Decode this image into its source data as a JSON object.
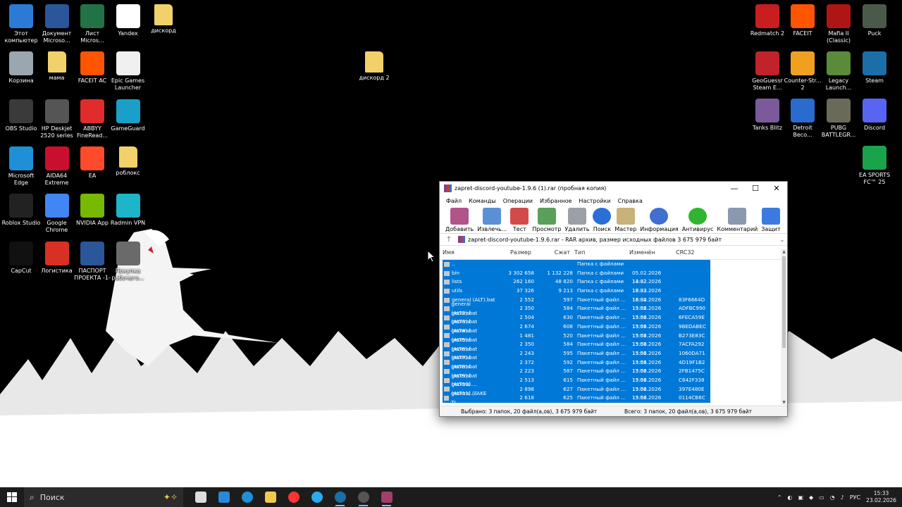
{
  "desktop": {
    "icons": [
      {
        "label": "Этот компьютер",
        "icon": "computer-icon",
        "color": "#2b7bd6"
      },
      {
        "label": "Документ Microso...",
        "icon": "word-doc-icon",
        "color": "#2b579a"
      },
      {
        "label": "Лист Micros...",
        "icon": "excel-icon",
        "color": "#217346"
      },
      {
        "label": "Yandex",
        "icon": "yandex-icon",
        "color": "#ffffff"
      },
      {
        "label": "дискорд",
        "icon": "folder-icon",
        "color": "#f2d16b"
      },
      {
        "label": "Корзина",
        "icon": "recycle-bin-icon",
        "color": "#9aa7b0"
      },
      {
        "label": "мама",
        "icon": "folder-icon",
        "color": "#f2d16b"
      },
      {
        "label": "FACEIT AC",
        "icon": "faceit-ac-icon",
        "color": "#ff5500"
      },
      {
        "label": "Epic Games Launcher",
        "icon": "epic-games-icon",
        "color": "#f0f0f0"
      },
      {
        "label": "OBS Studio",
        "icon": "obs-icon",
        "color": "#3a3a3a"
      },
      {
        "label": "HP Deskjet 2520 series",
        "icon": "printer-icon",
        "color": "#555555"
      },
      {
        "label": "ABBYY FineRead...",
        "icon": "abbyy-icon",
        "color": "#e22b2b"
      },
      {
        "label": "GameGuard",
        "icon": "gameguard-icon",
        "color": "#1aa0c8"
      },
      {
        "label": "Microsoft Edge",
        "icon": "edge-icon",
        "color": "#1f8fd6"
      },
      {
        "label": "AIDA64 Extreme",
        "icon": "aida64-icon",
        "color": "#c8102e"
      },
      {
        "label": "EA",
        "icon": "ea-icon",
        "color": "#ff4b2b"
      },
      {
        "label": "роблокс",
        "icon": "folder-icon",
        "color": "#f2d16b"
      },
      {
        "label": "Roblox Studio",
        "icon": "roblox-studio-icon",
        "color": "#222222"
      },
      {
        "label": "Google Chrome",
        "icon": "chrome-icon",
        "color": "#4285f4"
      },
      {
        "label": "NVIDIA App",
        "icon": "nvidia-icon",
        "color": "#76b900"
      },
      {
        "label": "Radmin VPN",
        "icon": "radmin-vpn-icon",
        "color": "#1cb5c9"
      },
      {
        "label": "CapCut",
        "icon": "capcut-icon",
        "color": "#111111"
      },
      {
        "label": "Логистика",
        "icon": "pdf-icon",
        "color": "#d93025"
      },
      {
        "label": "ПАСПОРТ ПРОЕКТА -1-",
        "icon": "word-doc-icon",
        "color": "#2b579a"
      },
      {
        "label": "Покупка рабочего...",
        "icon": "printer-doc-icon",
        "color": "#6a6a6a"
      },
      {
        "label": "дискорд 2",
        "icon": "folder-icon",
        "color": "#f2d16b"
      },
      {
        "label": "Redmatch 2",
        "icon": "redmatch-icon",
        "color": "#c81e1e"
      },
      {
        "label": "FACEIT",
        "icon": "faceit-icon",
        "color": "#ff5500"
      },
      {
        "label": "Mafia II (Classic)",
        "icon": "mafia-icon",
        "color": "#b01515"
      },
      {
        "label": "Puck",
        "icon": "puck-icon",
        "color": "#4a5a4a"
      },
      {
        "label": "GeoGuessr Steam E...",
        "icon": "geoguessr-icon",
        "color": "#c0232b"
      },
      {
        "label": "Counter-Str... 2",
        "icon": "cs2-icon",
        "color": "#f0a020"
      },
      {
        "label": "Legacy Launch...",
        "icon": "legacy-launcher-icon",
        "color": "#5b8a3a"
      },
      {
        "label": "Steam",
        "icon": "steam-icon",
        "color": "#1b6fa8"
      },
      {
        "label": "Tanks Blitz",
        "icon": "tanks-blitz-icon",
        "color": "#7a5a9a"
      },
      {
        "label": "Detroit Beco...",
        "icon": "detroit-icon",
        "color": "#2a6bd0"
      },
      {
        "label": "PUBG BATTLEGR...",
        "icon": "pubg-icon",
        "color": "#6a6a5a"
      },
      {
        "label": "Discord",
        "icon": "discord-icon",
        "color": "#5865f2"
      },
      {
        "label": "EA SPORTS FC™ 25",
        "icon": "ea-fc-icon",
        "color": "#1aa34a"
      }
    ]
  },
  "winrar": {
    "title": "zapret-discord-youtube-1.9.6 (1).rar (пробная копия)",
    "menu": [
      "Файл",
      "Команды",
      "Операции",
      "Избранное",
      "Настройки",
      "Справка"
    ],
    "toolbar": [
      {
        "label": "Добавить",
        "icon": "add-archive-icon",
        "color": "#b0548a"
      },
      {
        "label": "Извлечь...",
        "icon": "extract-icon",
        "color": "#5b8fd6"
      },
      {
        "label": "Тест",
        "icon": "test-icon",
        "color": "#d24a4a"
      },
      {
        "label": "Просмотр",
        "icon": "view-icon",
        "color": "#5aa05a"
      },
      {
        "label": "Удалить",
        "icon": "delete-icon",
        "color": "#9aa0a6"
      },
      {
        "label": "Поиск",
        "icon": "find-icon",
        "color": "#2b6fd6"
      },
      {
        "label": "Мастер",
        "icon": "wizard-icon",
        "color": "#c9b17a"
      },
      {
        "label": "Информация",
        "icon": "info-icon",
        "color": "#3f6fcf"
      },
      {
        "label": "Антивирус",
        "icon": "antivirus-icon",
        "color": "#2fb52f"
      },
      {
        "label": "Комментарий",
        "icon": "comment-icon",
        "color": "#8a99b0"
      },
      {
        "label": "Защит",
        "icon": "protect-icon",
        "color": "#3b7be0"
      }
    ],
    "path": "zapret-discord-youtube-1.9.6.rar - RAR архив, размер исходных файлов 3 675 979 байт",
    "columns": {
      "name": "Имя",
      "size": "Размер",
      "packed": "Сжат",
      "type": "Тип",
      "modified": "Изменён",
      "crc": "CRC32"
    },
    "rows": [
      {
        "name": "..",
        "size": "",
        "packed": "",
        "type": "Папка с файлами",
        "modified": "",
        "crc": ""
      },
      {
        "name": "bin",
        "size": "3 302 658",
        "packed": "1 132 228",
        "type": "Папка с файлами",
        "modified": "05.02.2026 14:32",
        "crc": ""
      },
      {
        "name": "lists",
        "size": "262 160",
        "packed": "48 820",
        "type": "Папка с файлами",
        "modified": "13.02.2026 16:33",
        "crc": ""
      },
      {
        "name": "utils",
        "size": "37 326",
        "packed": "9 213",
        "type": "Папка с файлами",
        "modified": "13.02.2026 16:34",
        "crc": ""
      },
      {
        "name": "general (ALT).bat",
        "size": "2 552",
        "packed": "597",
        "type": "Пакетный файл ...",
        "modified": "13.02.2026 15:56",
        "crc": "83F6664D"
      },
      {
        "name": "general (ALT2).bat",
        "size": "2 350",
        "packed": "584",
        "type": "Пакетный файл ...",
        "modified": "13.02.2026 15:56",
        "crc": "ADFBC990"
      },
      {
        "name": "general (ALT3).bat",
        "size": "2 504",
        "packed": "630",
        "type": "Пакетный файл ...",
        "modified": "13.02.2026 15:56",
        "crc": "6FECA59E"
      },
      {
        "name": "general (ALT4).bat",
        "size": "2 674",
        "packed": "608",
        "type": "Пакетный файл ...",
        "modified": "13.02.2026 15:56",
        "crc": "9BEDABEC"
      },
      {
        "name": "general (ALT5).bat",
        "size": "1 481",
        "packed": "520",
        "type": "Пакетный файл ...",
        "modified": "13.02.2026 15:56",
        "crc": "B273E83C"
      },
      {
        "name": "general (ALT6).bat",
        "size": "2 350",
        "packed": "584",
        "type": "Пакетный файл ...",
        "modified": "13.02.2026 15:56",
        "crc": "7ACFA292"
      },
      {
        "name": "general (ALT7).bat",
        "size": "2 243",
        "packed": "595",
        "type": "Пакетный файл ...",
        "modified": "13.02.2026 15:56",
        "crc": "1060DA71"
      },
      {
        "name": "general (ALT8).bat",
        "size": "2 372",
        "packed": "592",
        "type": "Пакетный файл ...",
        "modified": "13.02.2026 15:56",
        "crc": "4D19F1B2"
      },
      {
        "name": "general (ALT9).bat",
        "size": "2 223",
        "packed": "587",
        "type": "Пакетный файл ...",
        "modified": "13.02.2026 15:56",
        "crc": "2FB1475C"
      },
      {
        "name": "general (ALT10)....",
        "size": "2 513",
        "packed": "615",
        "type": "Пакетный файл ...",
        "modified": "13.02.2026 15:56",
        "crc": "C642F338"
      },
      {
        "name": "general (ALT11)....",
        "size": "2 898",
        "packed": "627",
        "type": "Пакетный файл ...",
        "modified": "13.02.2026 15:56",
        "crc": "397E480E"
      },
      {
        "name": "general (FAKE TL...",
        "size": "2 618",
        "packed": "625",
        "type": "Пакетный файл ...",
        "modified": "13.02.2026 15:56",
        "crc": "0114CB6C"
      }
    ],
    "status_left": "Выбрано: 3 папок, 20 файл(а,ов), 3 675 979 байт",
    "status_right": "Всего: 3 папок, 20 файл(а,ов), 3 675 979 байт"
  },
  "taskbar": {
    "search_placeholder": "Поиск",
    "apps": [
      {
        "icon": "task-view-icon",
        "color": "#dddddd"
      },
      {
        "icon": "store-icon",
        "color": "#2b88d8"
      },
      {
        "icon": "edge-icon",
        "color": "#1f8fd6"
      },
      {
        "icon": "file-explorer-icon",
        "color": "#f2c94c"
      },
      {
        "icon": "yandex-icon",
        "color": "#ff3333"
      },
      {
        "icon": "telegram-icon",
        "color": "#2aabee"
      },
      {
        "icon": "steam-icon",
        "color": "#1b6fa8"
      },
      {
        "icon": "obs-icon",
        "color": "#555555"
      },
      {
        "icon": "winrar-icon",
        "color": "#a0406a"
      }
    ],
    "lang": "РУС",
    "time": "15:33",
    "date": "23.02.2026"
  }
}
